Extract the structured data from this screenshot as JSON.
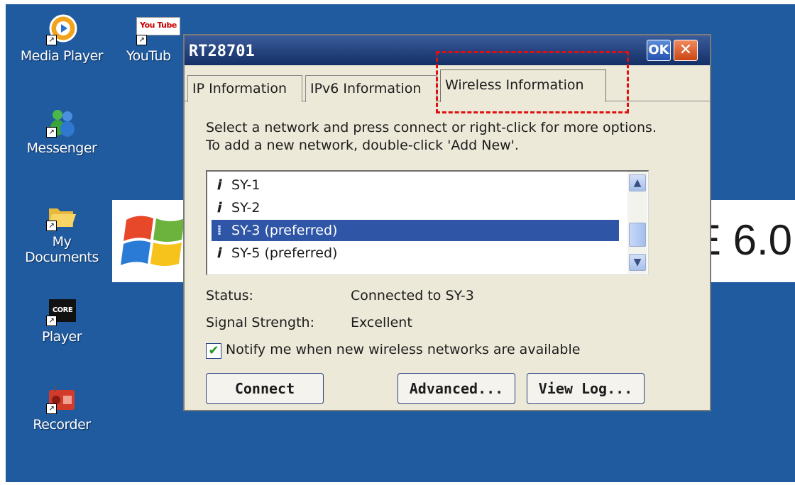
{
  "desktop": {
    "icons": [
      {
        "label": "Media Player",
        "icon": "media-player-icon"
      },
      {
        "label": "YouTub",
        "icon": "youtube-icon",
        "glyph": "You Tube"
      },
      {
        "label": "Messenger",
        "icon": "messenger-icon"
      },
      {
        "label": "My Documents",
        "icon": "folder-icon"
      },
      {
        "label": "Player",
        "icon": "core-player-icon",
        "glyph": "CORE"
      },
      {
        "label": "Recorder",
        "icon": "recorder-icon"
      }
    ],
    "banner_text": "E 6.0"
  },
  "dialog": {
    "title": "RT28701",
    "ok_label": "OK",
    "close_label": "✕",
    "tabs": [
      {
        "label": "IP Information"
      },
      {
        "label": "IPv6 Information"
      },
      {
        "label": "Wireless Information",
        "active": true
      }
    ],
    "description": "Select a network and press connect or right-click for more options.  To add a new network, double-click 'Add New'.",
    "networks": [
      {
        "name": "SY-1"
      },
      {
        "name": "SY-2"
      },
      {
        "name": "SY-3 (preferred)",
        "selected": true
      },
      {
        "name": "SY-5 (preferred)"
      }
    ],
    "status_label": "Status:",
    "status_value": "Connected to SY-3",
    "signal_label": "Signal Strength:",
    "signal_value": "Excellent",
    "notify_label": "Notify me when new wireless networks are available",
    "notify_checked": true,
    "buttons": {
      "connect": "Connect",
      "advanced": "Advanced...",
      "view_log": "View Log..."
    }
  },
  "colors": {
    "desktop_bg": "#1f5b9e",
    "selection": "#2f56a6",
    "highlight_box": "#e01010"
  }
}
